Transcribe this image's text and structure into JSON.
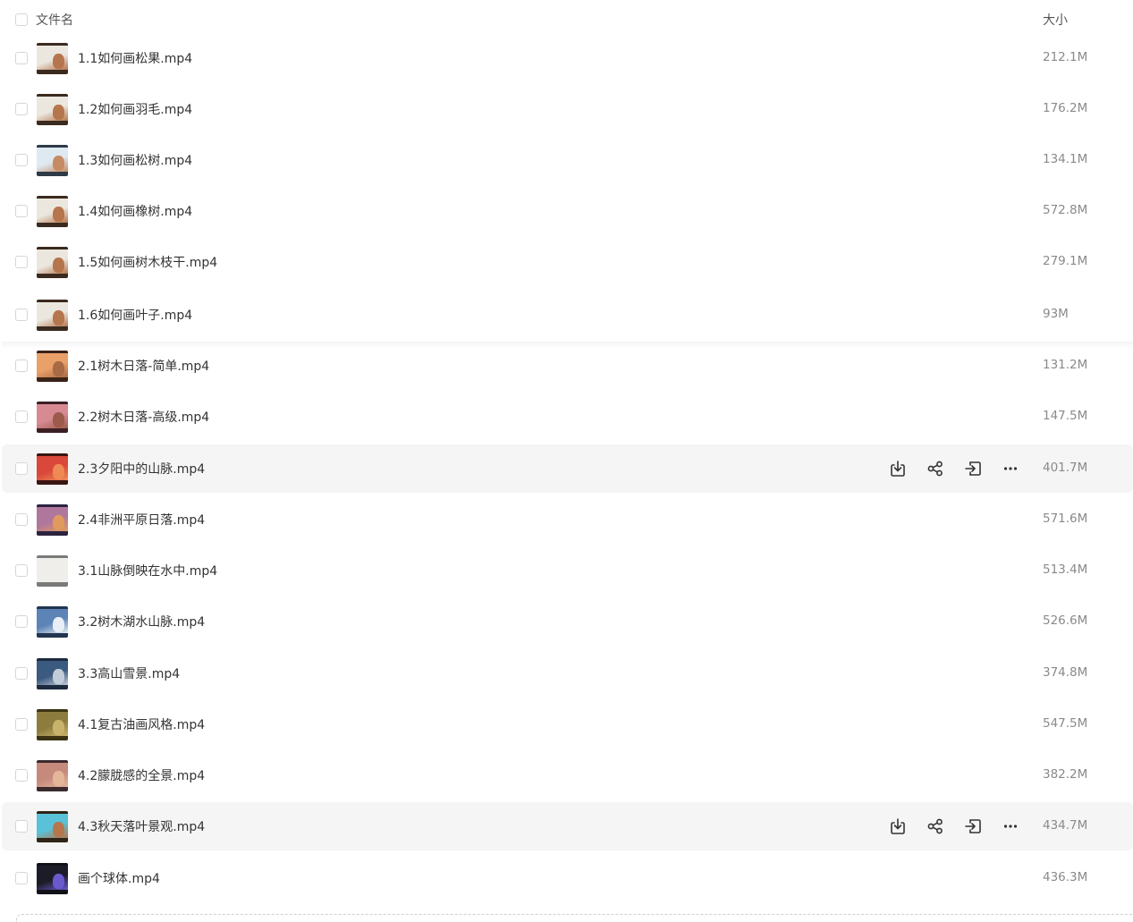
{
  "header": {
    "name_label": "文件名",
    "size_label": "大小"
  },
  "files": [
    {
      "name": "1.1如何画松果.mp4",
      "size": "212.1M",
      "thumbnail": "video-thumbnail-sketch",
      "hovered": false
    },
    {
      "name": "1.2如何画羽毛.mp4",
      "size": "176.2M",
      "thumbnail": "video-thumbnail-sketch",
      "hovered": false
    },
    {
      "name": "1.3如何画松树.mp4",
      "size": "134.1M",
      "thumbnail": "video-thumbnail-sketch-blue",
      "hovered": false
    },
    {
      "name": "1.4如何画橡树.mp4",
      "size": "572.8M",
      "thumbnail": "video-thumbnail-sketch",
      "hovered": false
    },
    {
      "name": "1.5如何画树木枝干.mp4",
      "size": "279.1M",
      "thumbnail": "video-thumbnail-sketch",
      "hovered": false
    },
    {
      "name": "1.6如何画叶子.mp4",
      "size": "93M",
      "thumbnail": "video-thumbnail-sketch",
      "hovered": false
    },
    {
      "name": "2.1树木日落-简单.mp4",
      "size": "131.2M",
      "thumbnail": "video-thumbnail-sunset",
      "hovered": false
    },
    {
      "name": "2.2树木日落-高级.mp4",
      "size": "147.5M",
      "thumbnail": "video-thumbnail-sunset-pink",
      "hovered": false
    },
    {
      "name": "2.3夕阳中的山脉.mp4",
      "size": "401.7M",
      "thumbnail": "video-thumbnail-red-mountains",
      "hovered": true
    },
    {
      "name": "2.4非洲平原日落.mp4",
      "size": "571.6M",
      "thumbnail": "video-thumbnail-purple-sunset",
      "hovered": false
    },
    {
      "name": "3.1山脉倒映在水中.mp4",
      "size": "513.4M",
      "thumbnail": "video-thumbnail-blank-paper",
      "hovered": false
    },
    {
      "name": "3.2树木湖水山脉.mp4",
      "size": "526.6M",
      "thumbnail": "video-thumbnail-snow-lake",
      "hovered": false
    },
    {
      "name": "3.3高山雪景.mp4",
      "size": "374.8M",
      "thumbnail": "video-thumbnail-snow-mountain",
      "hovered": false
    },
    {
      "name": "4.1复古油画风格.mp4",
      "size": "547.5M",
      "thumbnail": "video-thumbnail-oil-painting",
      "hovered": false
    },
    {
      "name": "4.2朦胧感的全景.mp4",
      "size": "382.2M",
      "thumbnail": "video-thumbnail-hazy-panorama",
      "hovered": false
    },
    {
      "name": "4.3秋天落叶景观.mp4",
      "size": "434.7M",
      "thumbnail": "video-thumbnail-autumn",
      "hovered": true
    },
    {
      "name": "画个球体.mp4",
      "size": "436.3M",
      "thumbnail": "video-thumbnail-dark-screen",
      "hovered": false
    }
  ],
  "row_actions": [
    {
      "name": "download",
      "icon": "download-icon"
    },
    {
      "name": "share",
      "icon": "share-icon"
    },
    {
      "name": "move",
      "icon": "move-to-icon"
    },
    {
      "name": "more",
      "icon": "more-icon"
    }
  ],
  "thumbnail_palettes": {
    "video-thumbnail-sketch": [
      "#3b2a1f",
      "#ebe7df",
      "#b6764d"
    ],
    "video-thumbnail-sketch-blue": [
      "#2f3a48",
      "#dfe9f2",
      "#c58b63"
    ],
    "video-thumbnail-sunset": [
      "#3a2217",
      "#e9a069",
      "#a86a44"
    ],
    "video-thumbnail-sunset-pink": [
      "#3b1f24",
      "#d88a93",
      "#9c5a4a"
    ],
    "video-thumbnail-red-mountains": [
      "#3a1512",
      "#d9483a",
      "#f08a55"
    ],
    "video-thumbnail-purple-sunset": [
      "#2b2340",
      "#b0779d",
      "#e09a5e"
    ],
    "video-thumbnail-blank-paper": [
      "#7a7a7a",
      "#efeeea",
      "#efeeea"
    ],
    "video-thumbnail-snow-lake": [
      "#23354f",
      "#5d84b6",
      "#e7eef6"
    ],
    "video-thumbnail-snow-mountain": [
      "#1d2a3d",
      "#3b5a80",
      "#c2ccd8"
    ],
    "video-thumbnail-oil-painting": [
      "#3a3212",
      "#8c7d3e",
      "#c9b26b"
    ],
    "video-thumbnail-hazy-panorama": [
      "#3a2a2e",
      "#c58a7c",
      "#e3b69a"
    ],
    "video-thumbnail-autumn": [
      "#2f2417",
      "#59c2d8",
      "#b6764d"
    ],
    "video-thumbnail-dark-screen": [
      "#111118",
      "#1c1c28",
      "#6a5acd"
    ]
  }
}
